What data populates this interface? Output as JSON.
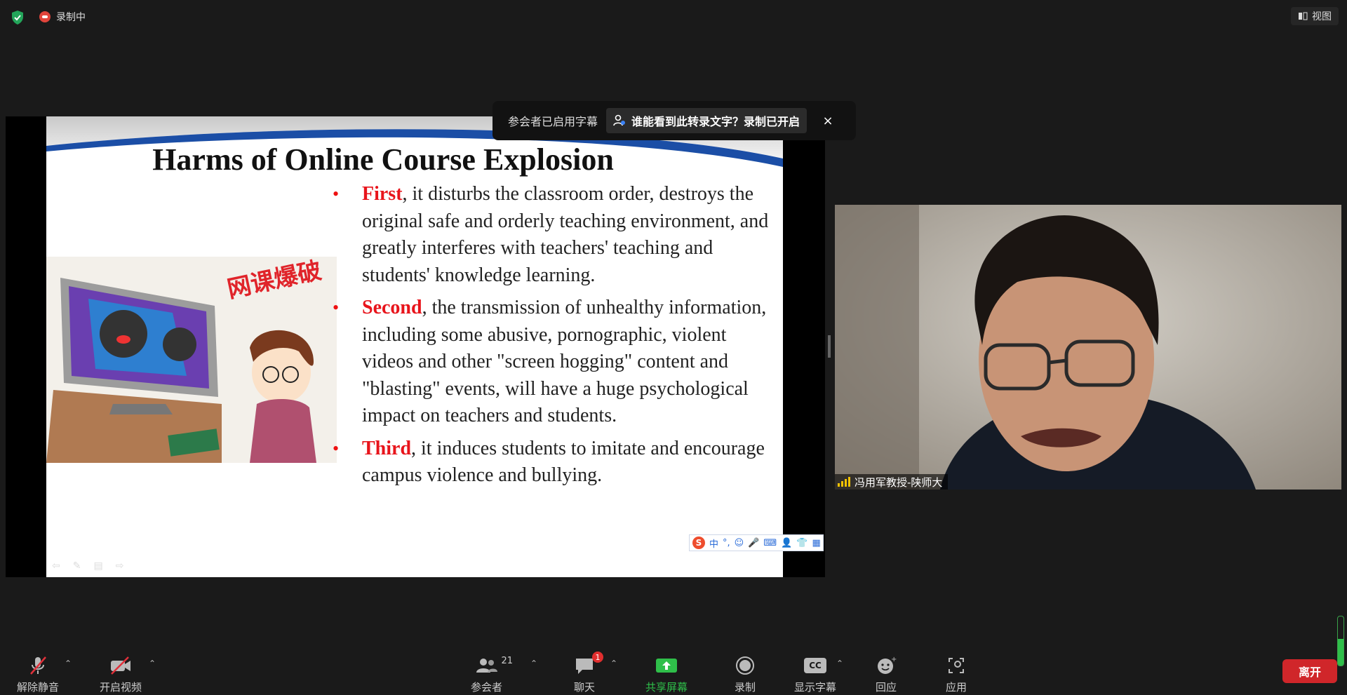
{
  "top": {
    "recording_label": "录制中",
    "view_label": "视图"
  },
  "caption_popup": {
    "text": "参会者已启用字幕",
    "link": "谁能看到此转录文字？录制已开启",
    "close": "×"
  },
  "slide": {
    "title": "Harms of Online Course Explosion",
    "image_caption": "网课爆破",
    "bullets": [
      {
        "keyword": "First",
        "text": ", it disturbs the classroom order, destroys the original safe and orderly teaching environment, and greatly interferes with teachers' teaching and students' knowledge learning."
      },
      {
        "keyword": "Second",
        "text": ", the transmission of unhealthy information, including some abusive, pornographic, violent videos and other \"screen hogging\" content and \"blasting\" events, will have a huge psychological impact on teachers and students."
      },
      {
        "keyword": "Third",
        "text": ", it induces students to imitate and encourage campus violence and bullying."
      }
    ],
    "ime_label": "中"
  },
  "video": {
    "participant_name": "冯用军教授-陕师大"
  },
  "toolbar": {
    "unmute": "解除静音",
    "start_video": "开启视频",
    "participants": "参会者",
    "participants_count": "21",
    "chat": "聊天",
    "chat_badge": "1",
    "share_screen": "共享屏幕",
    "record": "录制",
    "captions": "显示字幕",
    "captions_icon": "CC",
    "reactions": "回应",
    "apps": "应用",
    "leave": "离开"
  },
  "audio_level": 0.55,
  "colors": {
    "accent_green": "#2fbf4a",
    "leave_red": "#d0262a",
    "keyword_red": "#e8141b",
    "slide_blue": "#1b4ea6"
  }
}
